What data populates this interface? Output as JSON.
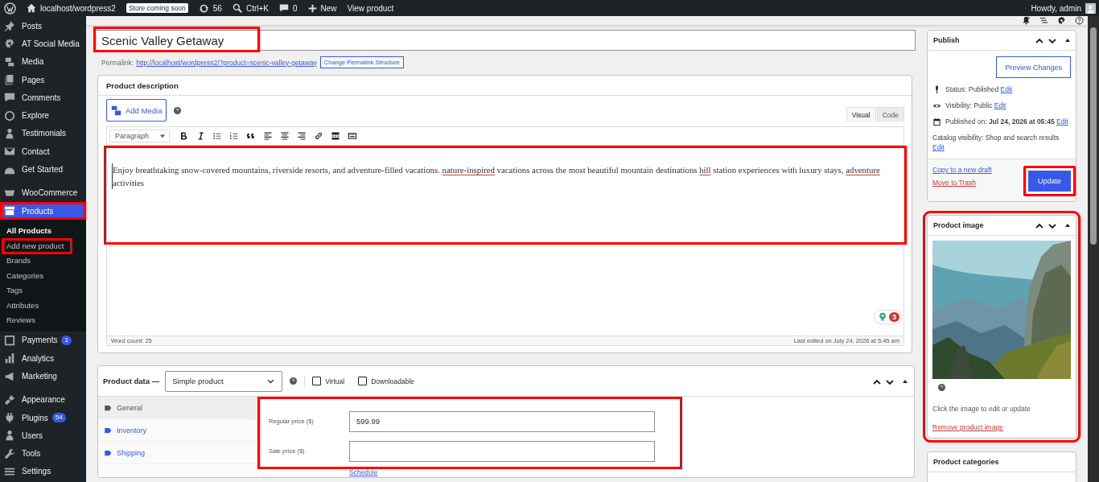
{
  "admin_bar": {
    "site": "localhost/wordpress2",
    "store_badge": "Store coming soon",
    "updates": "56",
    "search": "Ctrl+K",
    "comments": "0",
    "new": "New",
    "view": "View product",
    "howdy": "Howdy, admin"
  },
  "sidebar": {
    "groups": [
      {
        "items": [
          {
            "label": "Posts",
            "selected": false,
            "highlighted": false
          },
          {
            "label": "AT Social Media",
            "selected": false,
            "highlighted": false
          },
          {
            "label": "Media",
            "selected": false,
            "highlighted": false
          },
          {
            "label": "Pages",
            "selected": false,
            "highlighted": false
          },
          {
            "label": "Comments",
            "selected": false,
            "highlighted": false
          },
          {
            "label": "Explore",
            "selected": false,
            "highlighted": false
          },
          {
            "label": "Testimonials",
            "selected": false,
            "highlighted": false
          },
          {
            "label": "Contact",
            "selected": false,
            "highlighted": false
          },
          {
            "label": "Get Started",
            "selected": false,
            "highlighted": false
          }
        ]
      },
      {
        "items": [
          {
            "label": "WooCommerce",
            "selected": false,
            "highlighted": false
          },
          {
            "label": "Products",
            "selected": true,
            "highlighted": true,
            "children": [
              {
                "label": "All Products",
                "selected": true,
                "highlighted": false
              },
              {
                "label": "Add new product",
                "selected": false,
                "highlighted": true
              },
              {
                "label": "Brands",
                "selected": false,
                "highlighted": false
              },
              {
                "label": "Categories",
                "selected": false,
                "highlighted": false
              },
              {
                "label": "Tags",
                "selected": false,
                "highlighted": false
              },
              {
                "label": "Attributes",
                "selected": false,
                "highlighted": false
              },
              {
                "label": "Reviews",
                "selected": false,
                "highlighted": false
              }
            ]
          },
          {
            "label": "Payments",
            "selected": false,
            "highlighted": false,
            "badge": "1"
          },
          {
            "label": "Analytics",
            "selected": false,
            "highlighted": false
          },
          {
            "label": "Marketing",
            "selected": false,
            "highlighted": false
          }
        ]
      },
      {
        "items": [
          {
            "label": "Appearance",
            "selected": false,
            "highlighted": false
          },
          {
            "label": "Plugins",
            "selected": false,
            "highlighted": false,
            "badge": "54"
          },
          {
            "label": "Users",
            "selected": false,
            "highlighted": false
          },
          {
            "label": "Tools",
            "selected": false,
            "highlighted": false
          },
          {
            "label": "Settings",
            "selected": false,
            "highlighted": false
          }
        ]
      }
    ]
  },
  "title_field": {
    "value": "Scenic Valley Getaway",
    "highlighted": true
  },
  "permalink": {
    "label": "Permalink:",
    "url": "http://localhost/wordpress2/?product=scenic-valley-getaway",
    "button": "Change Permalink Structure"
  },
  "description": {
    "title": "Product description",
    "add_media": "Add Media",
    "tabs": [
      {
        "label": "Visual",
        "selected": true
      },
      {
        "label": "Code",
        "selected": false
      }
    ],
    "format": "Paragraph",
    "content": [
      {
        "text": "Enjoy breathtaking snow-covered mountains, riverside resorts, and adventure-filled vacations. ",
        "misspelled": false
      },
      {
        "text": "nature-inspired",
        "misspelled": true
      },
      {
        "text": " vacations across the most beautiful mountain destinations ",
        "misspelled": false
      },
      {
        "text": "hill",
        "misspelled": true
      },
      {
        "text": " station experiences with luxury stays, ",
        "misspelled": false
      },
      {
        "text": "adventure",
        "misspelled": true
      },
      {
        "text": " activities",
        "misspelled": false
      }
    ],
    "highlighted": true,
    "issues": "3",
    "word_count": "Word count: 25",
    "last_edited": "Last edited on July 24, 2026 at 5:45 am"
  },
  "product_data": {
    "title": "Product data —",
    "type": "Simple product",
    "options": [
      {
        "label": "Virtual",
        "checked": false
      },
      {
        "label": "Downloadable",
        "checked": false
      }
    ],
    "tabs": [
      {
        "label": "General",
        "selected": true
      },
      {
        "label": "Inventory",
        "selected": false
      },
      {
        "label": "Shipping",
        "selected": false
      }
    ],
    "highlighted": true,
    "fields": [
      {
        "label": "Regular price ($)",
        "value": "599.99"
      },
      {
        "label": "Sale price ($)"
      }
    ],
    "schedule": "Schedule"
  },
  "publish": {
    "title": "Publish",
    "preview": "Preview Changes",
    "rows": [
      {
        "text": "Status: Published",
        "edit": "Edit"
      },
      {
        "text": "Visibility: Public",
        "edit": "Edit"
      },
      {
        "text": "Published on: **Jul 24, 2026 at 05:45**",
        "edit": "Edit"
      },
      {
        "text": "Catalog visibility: Shop and search results",
        "edit": "Edit"
      }
    ],
    "copy": "Copy to a new draft",
    "trash": "Move to Trash",
    "update": "Update",
    "update_highlighted": true
  },
  "product_image": {
    "title": "Product image",
    "hint": "Click the image to edit or update",
    "remove": "Remove product image",
    "highlighted": true
  },
  "categories": {
    "title": "Product categories"
  }
}
